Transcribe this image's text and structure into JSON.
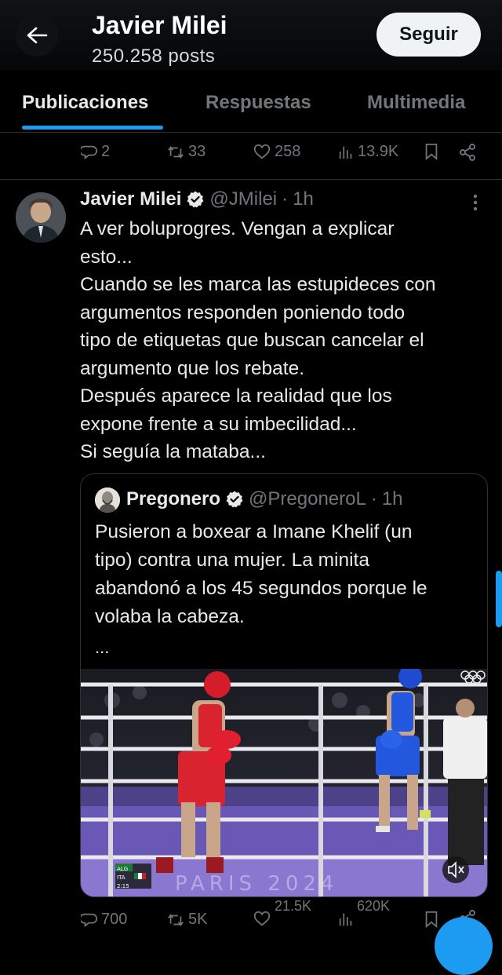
{
  "header": {
    "name": "Javier Milei",
    "posts": "250.258 posts",
    "follow_label": "Seguir"
  },
  "tabs": [
    {
      "label": "Publicaciones",
      "active": true
    },
    {
      "label": "Respuestas",
      "active": false
    },
    {
      "label": "Multimedia",
      "active": false
    }
  ],
  "prev_actions": {
    "replies": "2",
    "reposts": "33",
    "likes": "258",
    "views": "13.9K"
  },
  "tweet": {
    "author": "Javier Milei",
    "handle": "@JMilei",
    "dot": "·",
    "time": "1h",
    "verified": true,
    "lines": [
      "A ver boluprogres. Vengan a explicar",
      "esto...",
      "Cuando se les marca las estupideces con",
      "argumentos responden poniendo todo",
      "tipo de etiquetas que buscan cancelar el",
      "argumento que los rebate.",
      "Después aparece la realidad que los",
      "expone frente a su imbecilidad...",
      "Si seguía la mataba..."
    ],
    "quote": {
      "author": "Pregonero",
      "handle": "@PregoneroL",
      "dot": "·",
      "time": "1h",
      "lines": [
        "Pusieron a boxear a Imane Khelif (un",
        "tipo) contra una mujer.  La minita",
        "abandonó a los 45 segundos porque le",
        "volaba la cabeza."
      ],
      "ellipsis": "...",
      "scoreboard": [
        "ALG",
        "ITA",
        "2:15"
      ],
      "video_text": "PARIS 2024"
    },
    "actions": {
      "replies": "700",
      "reposts": "5K",
      "likes": "21.5K",
      "views": "620K"
    }
  },
  "colors": {
    "accent": "#1d9bf0",
    "background": "#000000",
    "muted": "#71767b",
    "text": "#e7e9ea"
  },
  "icons": [
    "back-arrow-icon",
    "verified-badge-icon",
    "more-icon",
    "reply-icon",
    "repost-icon",
    "like-icon",
    "views-icon",
    "bookmark-icon",
    "share-icon",
    "mute-icon"
  ]
}
